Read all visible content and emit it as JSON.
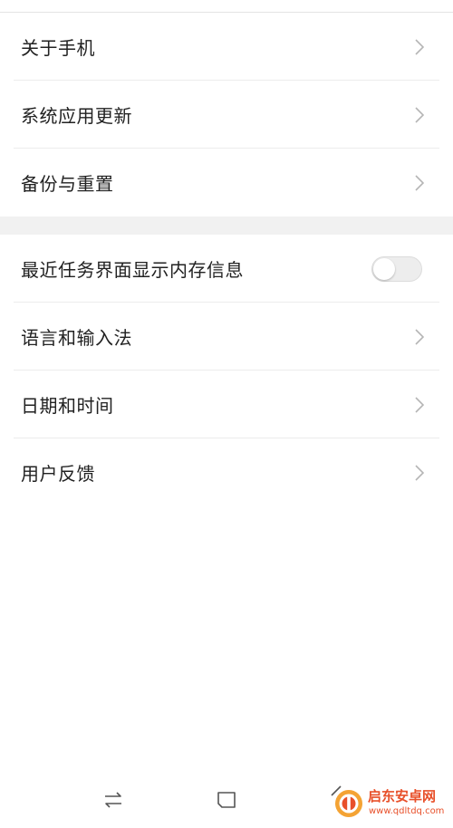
{
  "settings_groups": [
    {
      "items": [
        {
          "label": "关于手机",
          "control": "chevron"
        },
        {
          "label": "系统应用更新",
          "control": "chevron"
        },
        {
          "label": "备份与重置",
          "control": "chevron"
        }
      ]
    },
    {
      "items": [
        {
          "label": "最近任务界面显示内存信息",
          "control": "toggle",
          "checked": false
        },
        {
          "label": "语言和输入法",
          "control": "chevron"
        },
        {
          "label": "日期和时间",
          "control": "chevron"
        },
        {
          "label": "用户反馈",
          "control": "chevron"
        }
      ]
    }
  ],
  "navbar": {
    "icons": [
      "switch-apps-icon",
      "home-icon",
      "back-icon"
    ]
  },
  "watermark": {
    "title": "启东安卓网",
    "url": "www.qdltdq.com"
  },
  "colors": {
    "background": "#ffffff",
    "divider": "#ececec",
    "section_gap": "#f1f1f1",
    "text": "#222222",
    "chevron": "#b5b5b5",
    "toggle_off_track": "#ededed",
    "watermark": "#e8502a"
  }
}
